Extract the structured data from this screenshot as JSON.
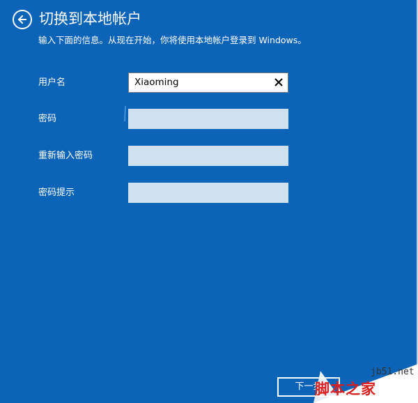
{
  "header": {
    "title": "切换到本地帐户",
    "subtitle": "输入下面的信息。从现在开始，你将使用本地帐户登录到 Windows。"
  },
  "form": {
    "username": {
      "label": "用户名",
      "value": "Xiaoming"
    },
    "password": {
      "label": "密码",
      "value": ""
    },
    "confirm_password": {
      "label": "重新输入密码",
      "value": ""
    },
    "password_hint": {
      "label": "密码提示",
      "value": ""
    }
  },
  "footer": {
    "next_label": "下一步"
  },
  "watermark": {
    "site": "jb51.net",
    "brand": "脚本之家"
  },
  "colors": {
    "background": "#0c64b8",
    "field_empty": "#cfe0ef",
    "field_active": "#ffffff",
    "watermark_red": "#d82020"
  },
  "icons": {
    "back": "back-arrow-icon",
    "clear": "close-icon"
  }
}
